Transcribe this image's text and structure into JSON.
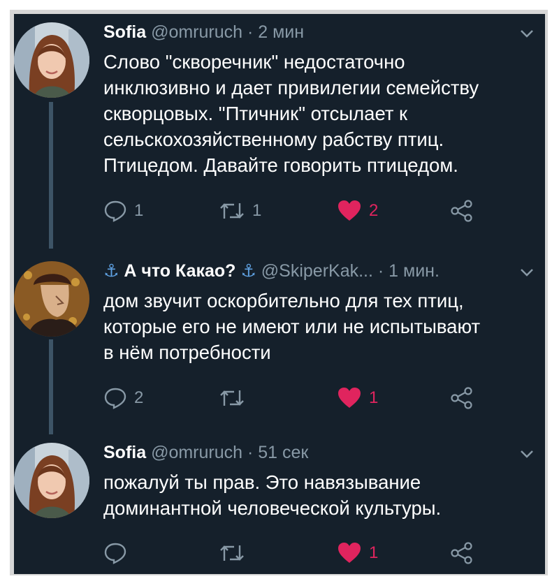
{
  "colors": {
    "background": "#15202b",
    "text": "#ffffff",
    "secondary": "#8899a6",
    "like": "#e0245e",
    "thread_line": "#3d5466",
    "anchor": "#5ea0e0"
  },
  "tweets": [
    {
      "name": "Sofia",
      "handle": "@omruruch · 2 мин",
      "text": "Слово \"скворечник\" недостаточно\nинклюзивно и дает привилегии семейству\nскворцовых. \"Птичник\" отсылает к\nсельскохозяйственному рабству птиц.\nПтицедом. Давайте говорить птицедом.",
      "reply_count": "1",
      "retweet_count": "1",
      "like_count": "2",
      "liked": true
    },
    {
      "name_prefix": "⚓",
      "name": "А что Какао?",
      "name_suffix": "⚓",
      "handle": "@SkiperKak... · 1 мин.",
      "text": "дом звучит оскорбительно для тех птиц,\nкоторые его не имеют или не испытывают\nв нём потребности",
      "reply_count": "2",
      "retweet_count": "",
      "like_count": "1",
      "liked": true
    },
    {
      "name": "Sofia",
      "handle": "@omruruch · 51 сек",
      "text": "пожалуй ты прав. Это навязывание\nдоминантной человеческой культуры.",
      "reply_count": "",
      "retweet_count": "",
      "like_count": "1",
      "liked": true
    }
  ],
  "icons": {
    "reply": "reply-icon",
    "retweet": "retweet-icon",
    "like": "heart-icon",
    "share": "share-icon",
    "menu": "chevron-down-icon"
  }
}
